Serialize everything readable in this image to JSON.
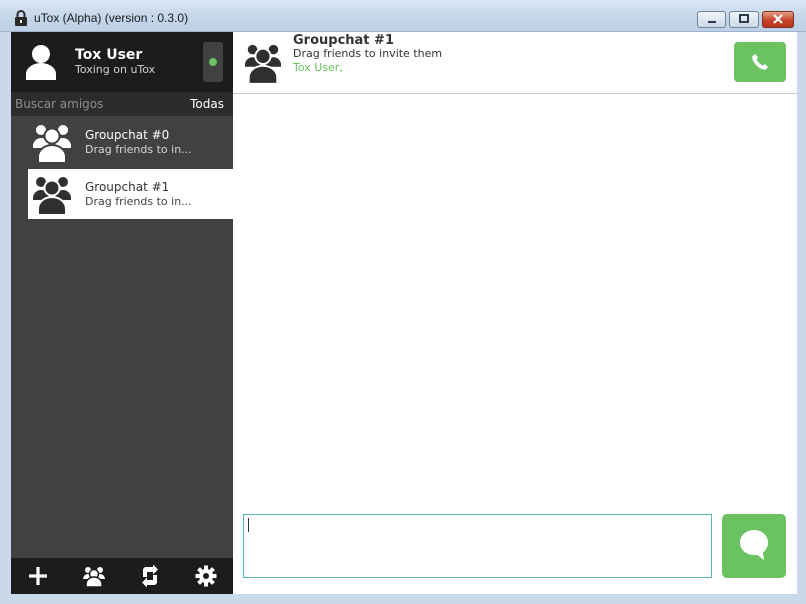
{
  "window": {
    "title": "uTox (Alpha) (version : 0.3.0)"
  },
  "self": {
    "name": "Tox User",
    "status_message": "Toxing on uTox",
    "status_color": "#6bc260"
  },
  "search": {
    "placeholder": "Buscar amigos",
    "filter_label": "Todas"
  },
  "contacts": [
    {
      "name": "Groupchat #0",
      "subtitle": "Drag friends to in...",
      "selected": false,
      "icon": "group-avatar-icon"
    },
    {
      "name": "Groupchat #1",
      "subtitle": "Drag friends to in...",
      "selected": true,
      "icon": "group-avatar-icon"
    }
  ],
  "bottom_bar": [
    {
      "icon": "add-icon"
    },
    {
      "icon": "create-group-icon"
    },
    {
      "icon": "transfers-icon"
    },
    {
      "icon": "settings-icon"
    }
  ],
  "chat": {
    "name": "Groupchat #1",
    "topic": "Drag friends to invite them",
    "peers": "Tox User,",
    "call_icon": "phone-icon",
    "send_icon": "chat-bubble-icon",
    "input_value": ""
  },
  "colors": {
    "accent_green": "#6bc260",
    "sidebar_bg": "#414141",
    "sidebar_dark": "#1c1c1c",
    "input_border": "#58b5b3"
  }
}
